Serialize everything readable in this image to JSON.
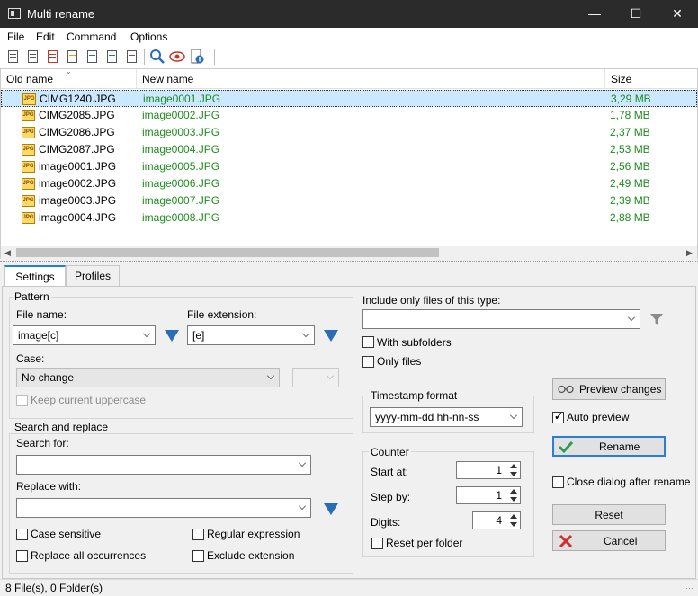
{
  "window": {
    "title": "Multi rename"
  },
  "menu": [
    "File",
    "Edit",
    "Command",
    "Options"
  ],
  "columns": {
    "old": "Old name",
    "new": "New name",
    "size": "Size"
  },
  "files": [
    {
      "old": "CIMG1240.JPG",
      "new": "image0001.JPG",
      "size": "3,29 MB"
    },
    {
      "old": "CIMG2085.JPG",
      "new": "image0002.JPG",
      "size": "1,78 MB"
    },
    {
      "old": "CIMG2086.JPG",
      "new": "image0003.JPG",
      "size": "2,37 MB"
    },
    {
      "old": "CIMG2087.JPG",
      "new": "image0004.JPG",
      "size": "2,53 MB"
    },
    {
      "old": "image0001.JPG",
      "new": "image0005.JPG",
      "size": "2,56 MB"
    },
    {
      "old": "image0002.JPG",
      "new": "image0006.JPG",
      "size": "2,49 MB"
    },
    {
      "old": "image0003.JPG",
      "new": "image0007.JPG",
      "size": "2,39 MB"
    },
    {
      "old": "image0004.JPG",
      "new": "image0008.JPG",
      "size": "2,88 MB"
    }
  ],
  "file_icon_text": "JPG",
  "tabs": [
    "Settings",
    "Profiles"
  ],
  "pattern": {
    "group": "Pattern",
    "file_name_label": "File name:",
    "file_name_value": "image[c]",
    "ext_label": "File extension:",
    "ext_value": "[e]",
    "case_label": "Case:",
    "case_value": "No change",
    "keep_upper": "Keep current uppercase"
  },
  "search": {
    "group": "Search and replace",
    "search_label": "Search for:",
    "search_value": "",
    "replace_label": "Replace with:",
    "replace_value": "",
    "case_sensitive": "Case sensitive",
    "regex": "Regular expression",
    "replace_all": "Replace all occurrences",
    "exclude_ext": "Exclude extension"
  },
  "filter": {
    "include_label": "Include only files of this type:",
    "include_value": "",
    "with_subfolders": "With subfolders",
    "only_files": "Only files"
  },
  "timestamp": {
    "group": "Timestamp format",
    "value": "yyyy-mm-dd hh-nn-ss"
  },
  "counter": {
    "group": "Counter",
    "start_label": "Start at:",
    "start_value": "1",
    "step_label": "Step by:",
    "step_value": "1",
    "digits_label": "Digits:",
    "digits_value": "4",
    "reset_per_folder": "Reset per folder"
  },
  "actions": {
    "preview": "Preview changes",
    "auto_preview": "Auto preview",
    "rename": "Rename",
    "close_after": "Close dialog after rename",
    "reset": "Reset",
    "cancel": "Cancel"
  },
  "status": "8 File(s), 0 Folder(s)",
  "colors": {
    "new_name": "#1e8c1e",
    "accent": "#2a7fd4",
    "arrow": "#2a6db4",
    "cancel_icon": "#d32f2f",
    "rename_icon": "#2e9e4e"
  }
}
